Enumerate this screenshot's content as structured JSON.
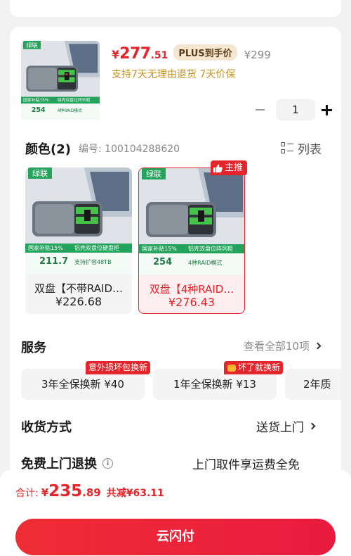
{
  "colors": {
    "accent": "#e5242b",
    "gold_text": "#c7901f",
    "plus_bg": "#f5e6cf"
  },
  "product": {
    "image": {
      "brand_logo": "绿联",
      "promo_badge": "国家补贴15%",
      "promo_price": "254",
      "promo_line": "铝壳双盘位阵列柜",
      "promo_sub": "4种RAID模式"
    },
    "price_symbol": "¥",
    "price_int": "277",
    "price_dec": ".51",
    "plus_tag": "PLUS到手价",
    "original_price": "¥299",
    "guarantee": "支持7天无理由退货  7天价保",
    "quantity": "1"
  },
  "color_section": {
    "title": "颜色(2)",
    "code": "编号: 100104288620",
    "view_toggle": "列表",
    "main_badge": "主推",
    "variants": [
      {
        "name": "双盘【不带RAID…",
        "price": "¥226.68",
        "image": {
          "brand_logo": "绿联",
          "promo_badge": "国家补贴15%",
          "promo_price": "211.7",
          "promo_line": "铝壳双盘位硬盘柜",
          "promo_sub": "支持扩容48TB"
        }
      },
      {
        "name": "双盘【4种RAID…",
        "price": "¥276.43",
        "image": {
          "brand_logo": "绿联",
          "promo_badge": "国家补贴15%",
          "promo_price": "254",
          "promo_line": "铝壳双盘位阵列柜",
          "promo_sub": "4种RAID模式"
        }
      }
    ]
  },
  "service": {
    "title": "服务",
    "view_all": "查看全部10项",
    "cards": [
      {
        "label": "3年全保换新 ¥40",
        "tag": "意外损坏包换新"
      },
      {
        "label": "1年全保换新 ¥13",
        "tag": "坏了就换新"
      },
      {
        "label": "2年质"
      }
    ]
  },
  "shipping": {
    "title": "收货方式",
    "value": "送货上门"
  },
  "free_return": {
    "title": "免费上门退换",
    "value": "上门取件享运费全免"
  },
  "footer": {
    "total_label": "合计:",
    "total_symbol": "¥",
    "total_int": "235",
    "total_dec": ".89",
    "discount": "共减¥63.11",
    "pay_button": "云闪付"
  }
}
